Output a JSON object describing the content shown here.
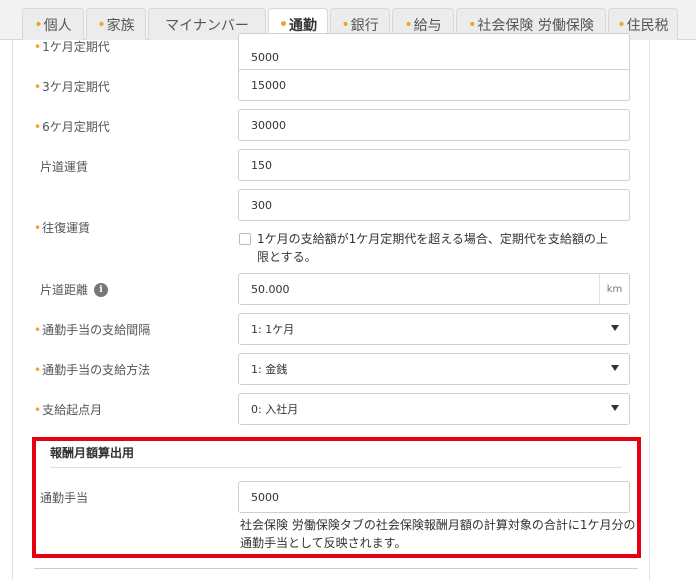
{
  "tabs": [
    {
      "label": "個人",
      "marked": true,
      "active": false
    },
    {
      "label": "家族",
      "marked": true,
      "active": false
    },
    {
      "label": "マイナンバー",
      "marked": false,
      "active": false
    },
    {
      "label": "通勤",
      "marked": true,
      "active": true
    },
    {
      "label": "銀行",
      "marked": true,
      "active": false
    },
    {
      "label": "給与",
      "marked": true,
      "active": false
    },
    {
      "label": "社会保険 労働保険",
      "marked": true,
      "active": false
    },
    {
      "label": "住民税",
      "marked": true,
      "active": false
    }
  ],
  "form": {
    "pass1": {
      "label": "1ケ月定期代",
      "value": "5000"
    },
    "pass3": {
      "label": "3ケ月定期代",
      "value": "15000"
    },
    "pass6": {
      "label": "6ケ月定期代",
      "value": "30000"
    },
    "oneway_fare": {
      "label": "片道運賃",
      "value": "150"
    },
    "round_fare": {
      "label": "往復運賃",
      "value": "300"
    },
    "cap_checkbox": {
      "text": "1ケ月の支給額が1ケ月定期代を超える場合、定期代を支給額の上限とする。",
      "checked": false
    },
    "distance": {
      "label": "片道距離",
      "value": "50.000",
      "unit": "km"
    },
    "interval": {
      "label": "通勤手当の支給間隔",
      "value": "1: 1ケ月"
    },
    "method": {
      "label": "通勤手当の支給方法",
      "value": "1: 金銭"
    },
    "start_month": {
      "label": "支給起点月",
      "value": "0: 入社月"
    }
  },
  "remuneration": {
    "title": "報酬月額算出用",
    "allowance_label": "通勤手当",
    "allowance_value": "5000",
    "note": "社会保険 労働保険タブの社会保険報酬月額の計算対象の合計に1ケ月分の通勤手当として反映されます。"
  },
  "colors": {
    "required_dot": "#f0a030",
    "highlight_border": "#e60012"
  },
  "icons": {
    "distance_info": "info-icon"
  }
}
